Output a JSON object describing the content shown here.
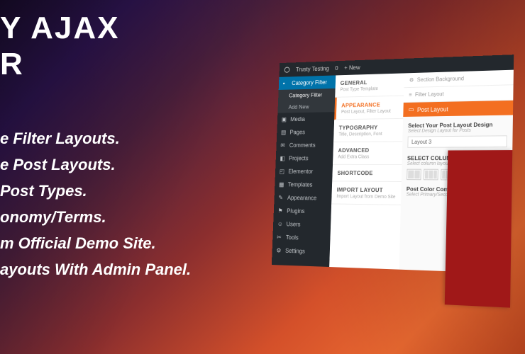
{
  "title_line1": "Y AJAX",
  "title_line2": "R",
  "features": [
    "e Filter Layouts.",
    "e Post Layouts.",
    " Post Types.",
    "onomy/Terms.",
    "m Official Demo Site.",
    "ayouts With Admin Panel."
  ],
  "adminbar": {
    "site": "Trusty Testing",
    "comments": "0",
    "new": "New"
  },
  "sidebar": {
    "active": "Category Filter",
    "subs": [
      "Category Filter",
      "Add New"
    ],
    "items": [
      "Media",
      "Pages",
      "Comments",
      "Projects",
      "Elementor",
      "Templates",
      "Appearance",
      "Plugins",
      "Users",
      "Tools",
      "Settings"
    ]
  },
  "midtabs": [
    {
      "h": "GENERAL",
      "d": "Post Type Template"
    },
    {
      "h": "APPEARANCE",
      "d": "Post Layout, Filter Layout"
    },
    {
      "h": "TYPOGRAPHY",
      "d": "Title, Description, Font"
    },
    {
      "h": "ADVANCED",
      "d": "Add Extra Class"
    },
    {
      "h": "SHORTCODE",
      "d": ""
    },
    {
      "h": "IMPORT LAYOUT",
      "d": "Import Layout from Demo Site"
    }
  ],
  "right": {
    "sectionBg": "Section Background",
    "filterLayout": "Filter Layout",
    "tab": "Post Layout",
    "designLbl": "Select Your Post Layout Design",
    "designHint": "Select Design Layout for Posts",
    "designVal": "Layout 3",
    "colLbl": "SELECT COLUMN LAYOUT",
    "colHint": "Select column layout of posts",
    "colorLbl": "Post Color Combination",
    "colorHint": "Select Primary/Secondary"
  }
}
